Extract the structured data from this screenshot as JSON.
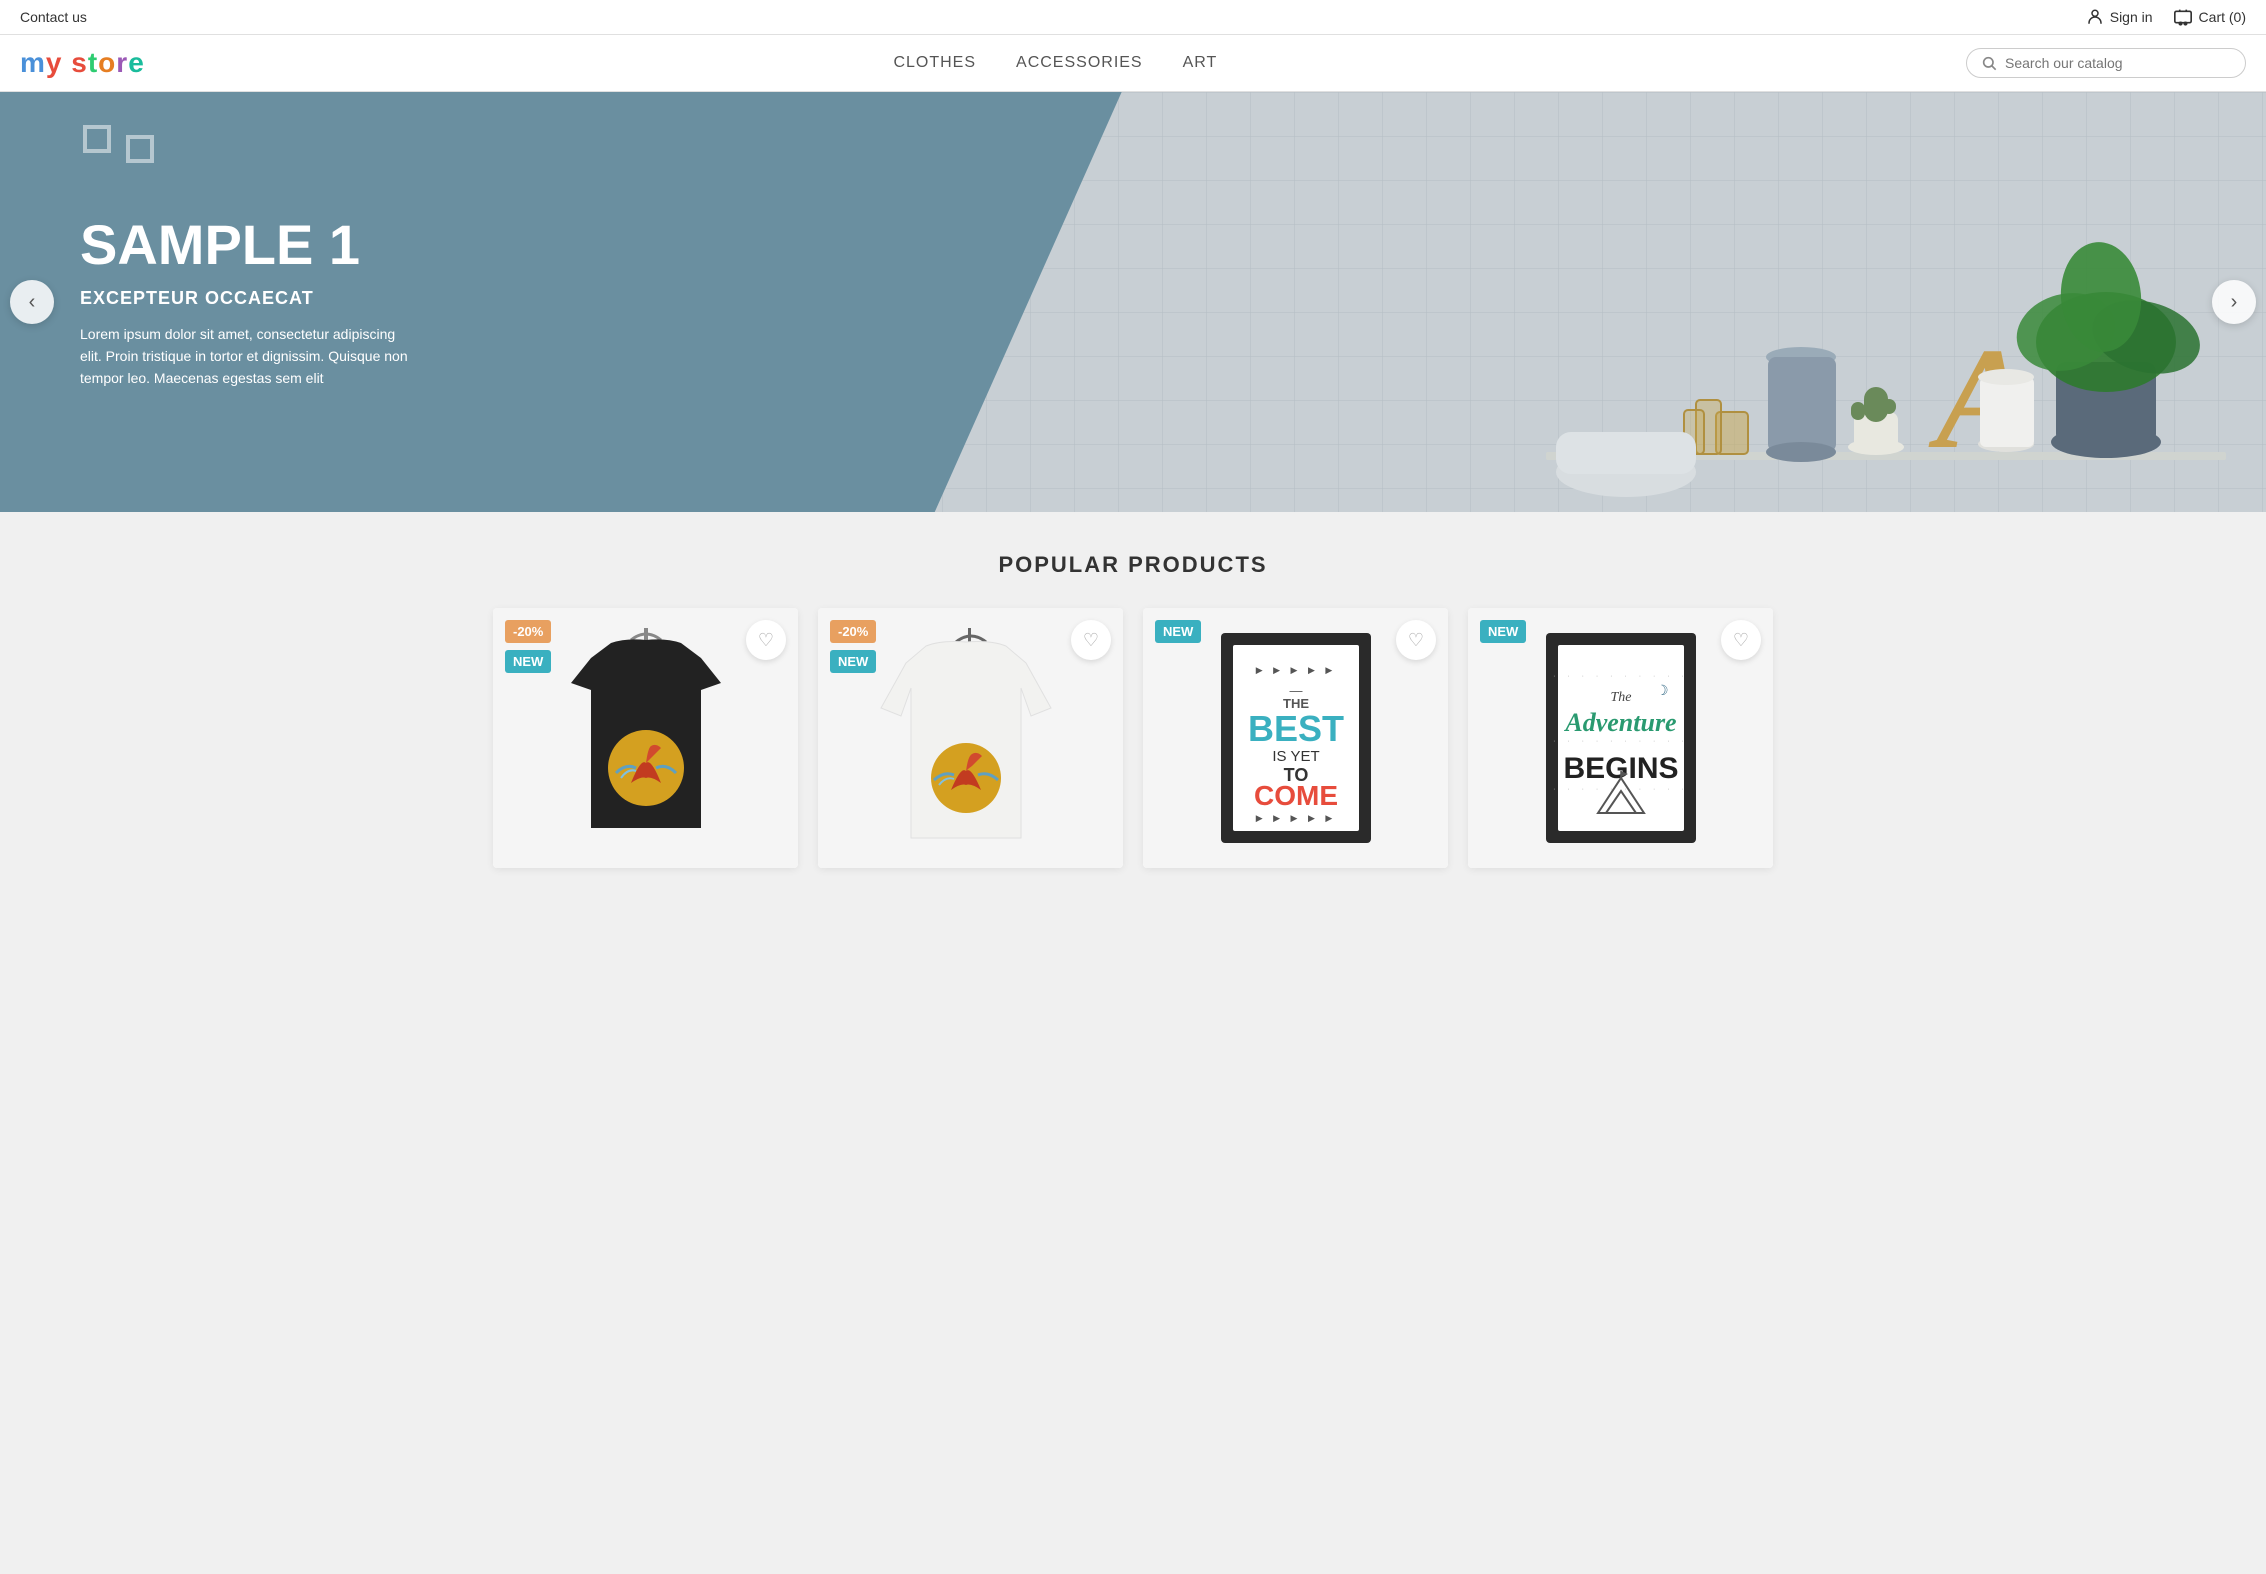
{
  "topbar": {
    "contact_label": "Contact us",
    "signin_label": "Sign in",
    "cart_label": "Cart (0)"
  },
  "header": {
    "logo": "my store",
    "logo_parts": {
      "m": "m",
      "y": "y",
      "space": " ",
      "s": "s",
      "t": "t",
      "o": "o",
      "r": "r",
      "e": "e"
    },
    "nav_items": [
      "CLOTHES",
      "ACCESSORIES",
      "ART"
    ],
    "search_placeholder": "Search our catalog"
  },
  "hero": {
    "prev_label": "‹",
    "next_label": "›",
    "title": "SAMPLE 1",
    "subtitle": "EXCEPTEUR OCCAECAT",
    "body": "Lorem ipsum dolor sit amet, consectetur adipiscing elit. Proin tristique in tortor et dignissim. Quisque non tempor leo. Maecenas egestas sem elit"
  },
  "products": {
    "section_title": "POPULAR PRODUCTS",
    "items": [
      {
        "id": 1,
        "badge_discount": "-20%",
        "badge_new": "NEW",
        "type": "tshirt-black"
      },
      {
        "id": 2,
        "badge_discount": "-20%",
        "badge_new": "NEW",
        "type": "tshirt-white"
      },
      {
        "id": 3,
        "badge_new": "NEW",
        "type": "poster-best"
      },
      {
        "id": 4,
        "badge_new": "NEW",
        "type": "poster-adventure"
      }
    ]
  }
}
